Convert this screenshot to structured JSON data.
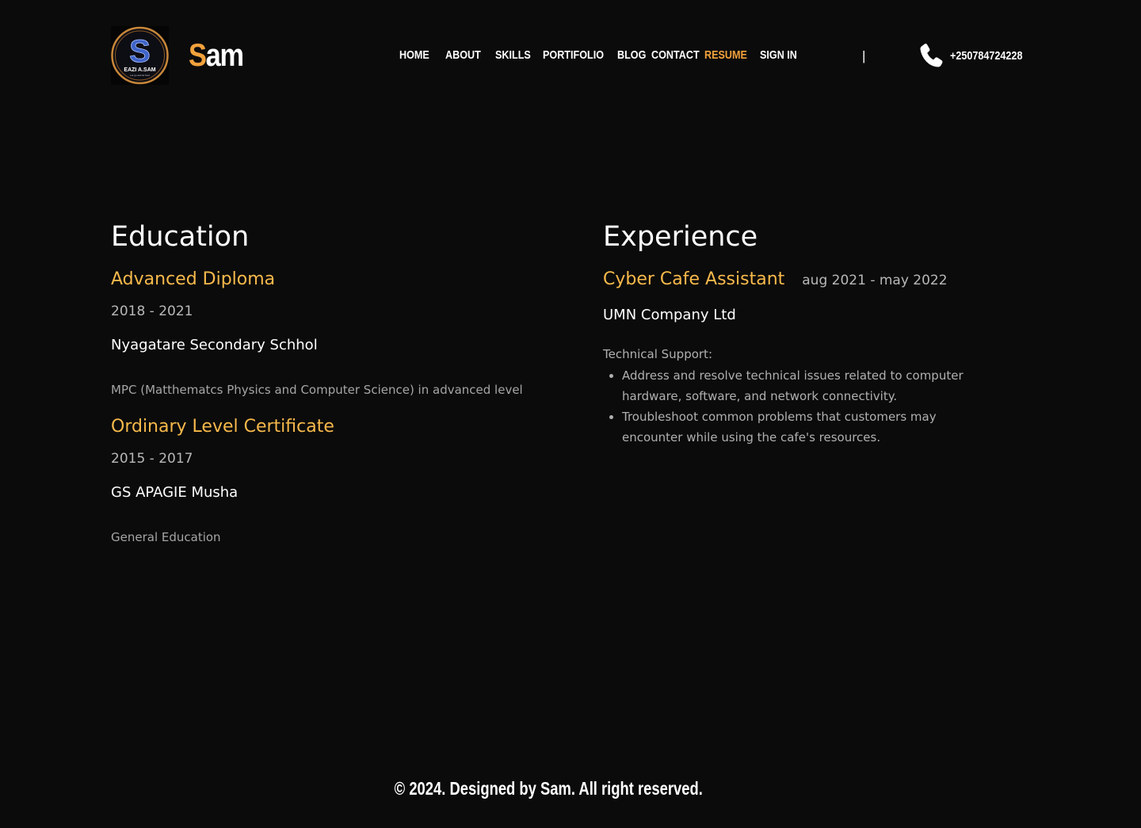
{
  "brand": {
    "logo_text": "EAZI A.SAM",
    "logo_tagline": "Let go and let God",
    "logo_letter": "S",
    "name_first": "S",
    "name_rest": "am"
  },
  "nav": {
    "items": [
      {
        "label": "HOME"
      },
      {
        "label": "ABOUT"
      },
      {
        "label": "SKILLS"
      },
      {
        "label": "PORTIFOLIO"
      },
      {
        "label": "BLOG"
      },
      {
        "label": "CONTACT"
      },
      {
        "label": "RESUME",
        "active": true
      },
      {
        "label": "SIGN IN"
      }
    ],
    "divider": "|",
    "phone_icon": "phone-icon",
    "phone": "+250784724228"
  },
  "education": {
    "title": "Education",
    "items": [
      {
        "title": "Advanced Diploma",
        "period": "2018 - 2021",
        "org": "Nyagatare Secondary Schhol",
        "desc": "MPC (Matthematcs Physics and Computer Science) in advanced level"
      },
      {
        "title": "Ordinary Level Certificate",
        "period": "2015 - 2017",
        "org": "GS APAGIE Musha",
        "desc": "General Education"
      }
    ]
  },
  "experience": {
    "title": "Experience",
    "items": [
      {
        "title": "Cyber Cafe Assistant",
        "period": "aug 2021 - may 2022",
        "org": "UMN Company Ltd",
        "subtitle": "Technical Support:",
        "bullets": [
          "Address and resolve technical issues related to computer hardware, software, and network connectivity.",
          "Troubleshoot common problems that customers may encounter while using the cafe's resources."
        ]
      }
    ]
  },
  "footer": {
    "text": "© 2024. Designed by Sam. All right reserved."
  },
  "colors": {
    "background": "#0b0b0b",
    "accent": "#f2a23c",
    "item_title": "#f7b94b",
    "text": "#ffffff",
    "muted": "#b0b0b0"
  }
}
